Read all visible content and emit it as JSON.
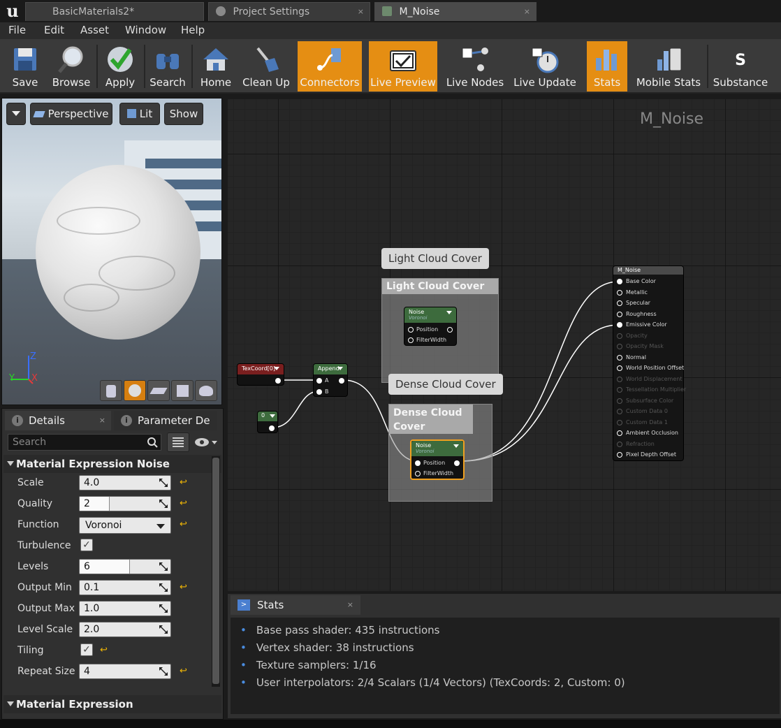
{
  "tabs": [
    {
      "label": "BasicMaterials2*",
      "close": ""
    },
    {
      "label": "Project Settings",
      "close": "×"
    },
    {
      "label": "M_Noise",
      "close": "×"
    }
  ],
  "menu": [
    "File",
    "Edit",
    "Asset",
    "Window",
    "Help"
  ],
  "toolbar": [
    {
      "label": "Save",
      "icon": "floppy-save-icon",
      "active": false
    },
    {
      "label": "Browse",
      "icon": "magnifier-browse-icon",
      "active": false
    },
    {
      "label": "Apply",
      "icon": "checkmark-apply-icon",
      "active": false
    },
    {
      "label": "Search",
      "icon": "binoculars-search-icon",
      "active": false
    },
    {
      "label": "Home",
      "icon": "house-home-icon",
      "active": false
    },
    {
      "label": "Clean Up",
      "icon": "broom-cleanup-icon",
      "active": false
    },
    {
      "label": "Connectors",
      "icon": "connectors-icon",
      "active": true
    },
    {
      "label": "Live Preview",
      "icon": "tv-preview-icon",
      "active": true
    },
    {
      "label": "Live Nodes",
      "icon": "live-nodes-icon",
      "active": false
    },
    {
      "label": "Live Update",
      "icon": "live-update-icon",
      "active": false
    },
    {
      "label": "Stats",
      "icon": "bar-chart-stats-icon",
      "active": true
    },
    {
      "label": "Mobile Stats",
      "icon": "mobile-stats-icon",
      "active": false
    },
    {
      "label": "Substance",
      "icon": "substance-icon",
      "active": false
    }
  ],
  "viewport": {
    "perspective": "Perspective",
    "lit": "Lit",
    "show": "Show",
    "axis_z": "Z",
    "axis_y": "Y",
    "axis_x": "X"
  },
  "details": {
    "tab_details": "Details",
    "tab_params": "Parameter De",
    "search_placeholder": "Search",
    "section1": "Material Expression Noise",
    "section2": "Material Expression",
    "props": [
      {
        "name": "Scale",
        "kind": "number",
        "value": "4.0",
        "reset": true
      },
      {
        "name": "Quality",
        "kind": "slider",
        "value": "2",
        "fill": 0.33,
        "reset": true
      },
      {
        "name": "Function",
        "kind": "dropdown",
        "value": "Voronoi",
        "reset": true
      },
      {
        "name": "Turbulence",
        "kind": "check",
        "value": "✓",
        "reset": false
      },
      {
        "name": "Levels",
        "kind": "slider",
        "value": "6",
        "fill": 0.55,
        "reset": false
      },
      {
        "name": "Output Min",
        "kind": "number",
        "value": "0.1",
        "reset": true
      },
      {
        "name": "Output Max",
        "kind": "number",
        "value": "1.0",
        "reset": false
      },
      {
        "name": "Level Scale",
        "kind": "number",
        "value": "2.0",
        "reset": false
      },
      {
        "name": "Tiling",
        "kind": "check",
        "value": "✓",
        "reset": true
      },
      {
        "name": "Repeat Size",
        "kind": "number",
        "value": "4",
        "reset": true
      }
    ],
    "reset_glyph": "↩"
  },
  "graph": {
    "title": "M_Noise",
    "comment_light_bubble": "Light Cloud Cover",
    "comment_light_header": "Light Cloud Cover",
    "comment_dense_bubble": "Dense Cloud Cover",
    "comment_dense_header": "Dense Cloud Cover",
    "noise_title": "Noise",
    "noise_sub": "Voronoi",
    "pin_position": "Position",
    "pin_filterwidth": "FilterWidth",
    "texcoord": "TexCoord[0]",
    "append": "Append",
    "append_a": "A",
    "append_b": "B",
    "const_zero": "0",
    "result_title": "M_Noise",
    "result_pins": [
      {
        "label": "Base Color",
        "state": "connected"
      },
      {
        "label": "Metallic",
        "state": "open"
      },
      {
        "label": "Specular",
        "state": "open"
      },
      {
        "label": "Roughness",
        "state": "open"
      },
      {
        "label": "Emissive Color",
        "state": "connected"
      },
      {
        "label": "Opacity",
        "state": "dim"
      },
      {
        "label": "Opacity Mask",
        "state": "dim"
      },
      {
        "label": "Normal",
        "state": "open"
      },
      {
        "label": "World Position Offset",
        "state": "open"
      },
      {
        "label": "World Displacement",
        "state": "dim"
      },
      {
        "label": "Tessellation Multiplier",
        "state": "dim"
      },
      {
        "label": "Subsurface Color",
        "state": "dim"
      },
      {
        "label": "Custom Data 0",
        "state": "dim"
      },
      {
        "label": "Custom Data 1",
        "state": "dim"
      },
      {
        "label": "Ambient Occlusion",
        "state": "open"
      },
      {
        "label": "Refraction",
        "state": "dim"
      },
      {
        "label": "Pixel Depth Offset",
        "state": "open"
      }
    ]
  },
  "stats": {
    "tab": "Stats",
    "tab_close": "×",
    "lines": [
      "Base pass shader: 435 instructions",
      "Vertex shader: 38 instructions",
      "Texture samplers: 1/16",
      "User interpolators: 2/4 Scalars (1/4 Vectors) (TexCoords: 2, Custom: 0)"
    ]
  },
  "colors": {
    "accent_orange": "#e58e13",
    "texcoord_header": "#7a1f1f",
    "append_header": "#3d6b3d",
    "const_header": "#3d6b3d",
    "noise_header": "#3d6b3d",
    "selected_outline": "#f0a020"
  }
}
